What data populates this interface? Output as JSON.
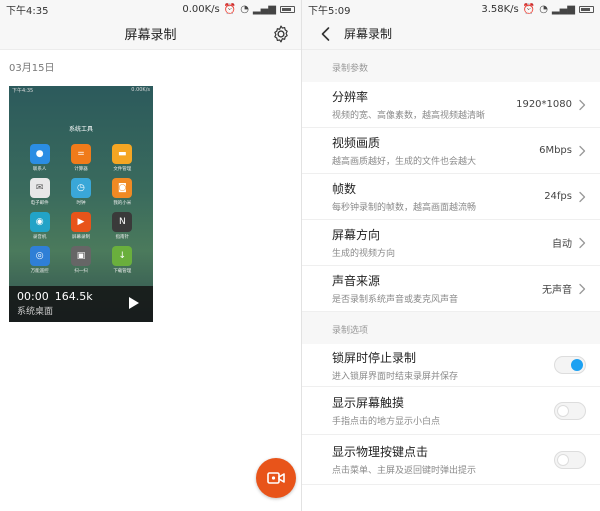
{
  "left_panel": {
    "statusbar": {
      "time": "下午4:35",
      "speed": "0.00K/s"
    },
    "title": "屏幕录制",
    "date_label": "03月15日",
    "recording": {
      "duration": "00:00",
      "size": "164.5k",
      "caption": "系统桌面",
      "thumbnail": {
        "status_time": "下午4:35",
        "status_speed": "0.00K/s",
        "folder_title": "系统工具",
        "apps": [
          {
            "name": "联系人",
            "icon": "contacts-icon",
            "color": "#2b8de3",
            "glyph": "●"
          },
          {
            "name": "计算器",
            "icon": "calculator-icon",
            "color": "#f07b1a",
            "glyph": "="
          },
          {
            "name": "文件管理",
            "icon": "folder-icon",
            "color": "#f5a623",
            "glyph": "▬"
          },
          {
            "name": "电子邮件",
            "icon": "mail-icon",
            "color": "#e8e8e8",
            "glyph": "✉"
          },
          {
            "name": "时钟",
            "icon": "clock-icon",
            "color": "#3aa7d8",
            "glyph": "◷"
          },
          {
            "name": "我的小米",
            "icon": "mi-icon",
            "color": "#f08a24",
            "glyph": "◙"
          },
          {
            "name": "录音机",
            "icon": "recorder-icon",
            "color": "#22a3c7",
            "glyph": "◉"
          },
          {
            "name": "屏幕录制",
            "icon": "screen-record-icon",
            "color": "#e8541a",
            "glyph": "▶"
          },
          {
            "name": "指南针",
            "icon": "compass-icon",
            "color": "#3a3a3a",
            "glyph": "N"
          },
          {
            "name": "万能遥控",
            "icon": "remote-icon",
            "color": "#2f7fd6",
            "glyph": "◎"
          },
          {
            "name": "扫一扫",
            "icon": "scan-icon",
            "color": "#666666",
            "glyph": "▣"
          },
          {
            "name": "下载管理",
            "icon": "download-icon",
            "color": "#6aaf3d",
            "glyph": "↓"
          }
        ]
      }
    }
  },
  "right_panel": {
    "statusbar": {
      "time": "下午5:09",
      "speed": "3.58K/s"
    },
    "title": "屏幕录制",
    "sections": [
      {
        "header": "录制参数",
        "rows": [
          {
            "label": "分辨率",
            "sub": "视频的宽、高像素数，越高视频越清晰",
            "value": "1920*1080"
          },
          {
            "label": "视频画质",
            "sub": "越高画质越好，生成的文件也会越大",
            "value": "6Mbps"
          },
          {
            "label": "帧数",
            "sub": "每秒钟录制的帧数，越高画面越流畅",
            "value": "24fps"
          },
          {
            "label": "屏幕方向",
            "sub": "生成的视频方向",
            "value": "自动"
          },
          {
            "label": "声音来源",
            "sub": "是否录制系统声音或麦克风声音",
            "value": "无声音"
          }
        ]
      },
      {
        "header": "录制选项",
        "rows": [
          {
            "label": "锁屏时停止录制",
            "sub": "进入锁屏界面时结束录屏并保存",
            "toggle": true
          },
          {
            "label": "显示屏幕触摸",
            "sub": "手指点击的地方显示小白点",
            "toggle": false
          },
          {
            "label": "显示物理按键点击",
            "sub": "点击菜单、主屏及返回键时弹出提示",
            "toggle": false
          }
        ]
      }
    ]
  },
  "colors": {
    "accent": "#e8541a",
    "toggle_on": "#1da1f2"
  }
}
